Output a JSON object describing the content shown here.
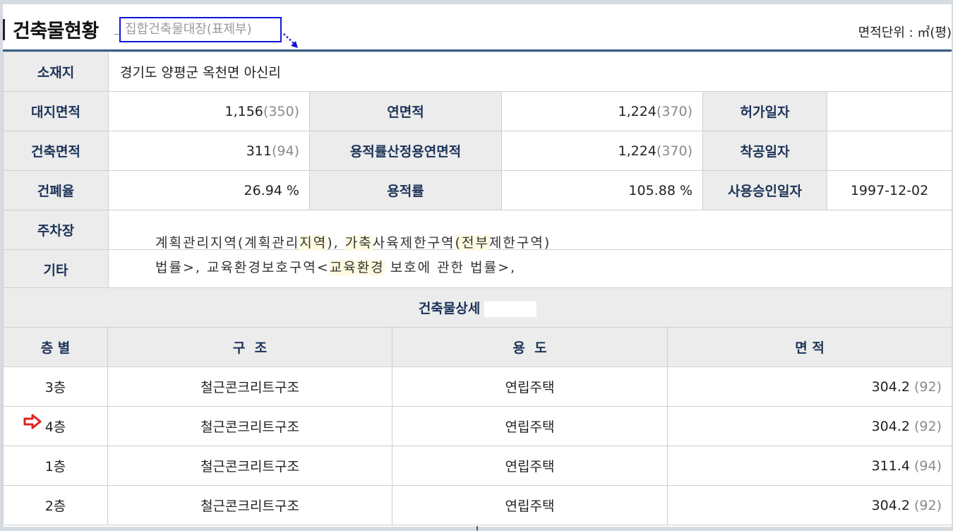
{
  "header": {
    "title": "건축물현황",
    "subtitle": "집합건축물대장(표제부)",
    "unit": "면적단위 : ㎡(평)"
  },
  "info": {
    "location_label": "소재지",
    "location_value": "경기도 양평군 옥천면 아신리",
    "site_area_label": "대지면적",
    "site_area_value": "1,156",
    "site_area_pyeong": "(350)",
    "total_floor_area_label": "연면적",
    "total_floor_area_value": "1,224",
    "total_floor_area_pyeong": "(370)",
    "permit_date_label": "허가일자",
    "permit_date_value": "",
    "building_area_label": "건축면적",
    "building_area_value": "311",
    "building_area_pyeong": "(94)",
    "far_calc_area_label": "용적률산정용연면적",
    "far_calc_area_value": "1,224",
    "far_calc_area_pyeong": "(370)",
    "construction_start_label": "착공일자",
    "construction_start_value": "",
    "coverage_label": "건폐율",
    "coverage_value": "26.94 %",
    "far_label": "용적률",
    "far_value": "105.88 %",
    "approval_date_label": "사용승인일자",
    "approval_date_value": "1997-12-02",
    "parking_label": "주차장",
    "other_label": "기타",
    "other_line1_a": "계획관리지역(계획관리",
    "other_line1_b": "지역",
    "other_line1_c": "),",
    "other_line1_d": "가축",
    "other_line1_e": "사육제한구역",
    "other_line1_f": "(전부",
    "other_line1_g": "제한구역)",
    "other_line2_a": "법률>, 교육환경보호구역<",
    "other_line2_b": "교육환경",
    "other_line2_c": " 보호에 관한 법률>,"
  },
  "detail": {
    "section_title": "건축물상세",
    "col_floor": "층 별",
    "col_structure": "구  조",
    "col_use": "용  도",
    "col_area": "면 적",
    "rows": [
      {
        "floor": "3층",
        "structure": "철근콘크리트구조",
        "use": "연립주택",
        "area": "304.2",
        "pyeong": "(92)"
      },
      {
        "floor": "4층",
        "structure": "철근콘크리트구조",
        "use": "연립주택",
        "area": "304.2",
        "pyeong": "(92)"
      },
      {
        "floor": "1층",
        "structure": "철근콘크리트구조",
        "use": "연립주택",
        "area": "311.4",
        "pyeong": "(94)"
      },
      {
        "floor": "2층",
        "structure": "철근콘크리트구조",
        "use": "연립주택",
        "area": "304.2",
        "pyeong": "(92)"
      }
    ]
  },
  "colors": {
    "header_rule": "#3b5e86",
    "label_text": "#1c3358",
    "label_bg": "#ececec",
    "subtitle_border": "#1414d8",
    "marker_arrow": "#e02020"
  },
  "icons": {
    "selected_row_marker": "red-right-arrow-icon",
    "subtitle_pointer": "dotted-arrow-icon"
  }
}
